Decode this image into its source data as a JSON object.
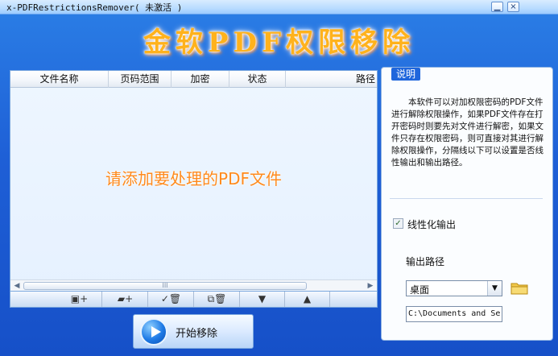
{
  "window": {
    "title": "x-PDFRestrictionsRemover( 未激活 )",
    "minimize_glyph": "▁",
    "close_glyph": "×"
  },
  "banner": {
    "text": "金软PDF权限移除",
    "color": "#ffb21c"
  },
  "file_list": {
    "columns": [
      "文件名称",
      "页码范围",
      "加密",
      "状态",
      "路径"
    ],
    "empty_hint": "请添加要处理的PDF文件",
    "scroll_thumb_grip": "III",
    "scroll_left_glyph": "◀",
    "scroll_right_glyph": "▶"
  },
  "toolbar": {
    "buttons": [
      {
        "icon": "add-file-icon",
        "glyph": "▣+"
      },
      {
        "icon": "add-folder-icon",
        "glyph": "▰+"
      },
      {
        "icon": "remove-selected-icon",
        "glyph": "✓🗑"
      },
      {
        "icon": "remove-all-icon",
        "glyph": "⧉🗑"
      },
      {
        "icon": "move-down-icon",
        "glyph": "▼"
      },
      {
        "icon": "move-up-icon",
        "glyph": "▲"
      }
    ]
  },
  "start_button": {
    "label": "开始移除",
    "icon": "play-icon"
  },
  "panel": {
    "legend": "说明",
    "description": "本软件可以对加权限密码的PDF文件进行解除权限操作，如果PDF文件存在打开密码时则要先对文件进行解密，如果文件只存在权限密码，则可直接对其进行解除权限操作，分隔线以下可以设置是否线性输出和输出路径。",
    "linearize": {
      "label": "线性化输出",
      "checked": true,
      "check_glyph": "✓"
    },
    "output_label": "输出路径",
    "output_select": {
      "value": "桌面",
      "drop_glyph": "▼"
    },
    "path_value": "C:\\Documents and Se"
  }
}
